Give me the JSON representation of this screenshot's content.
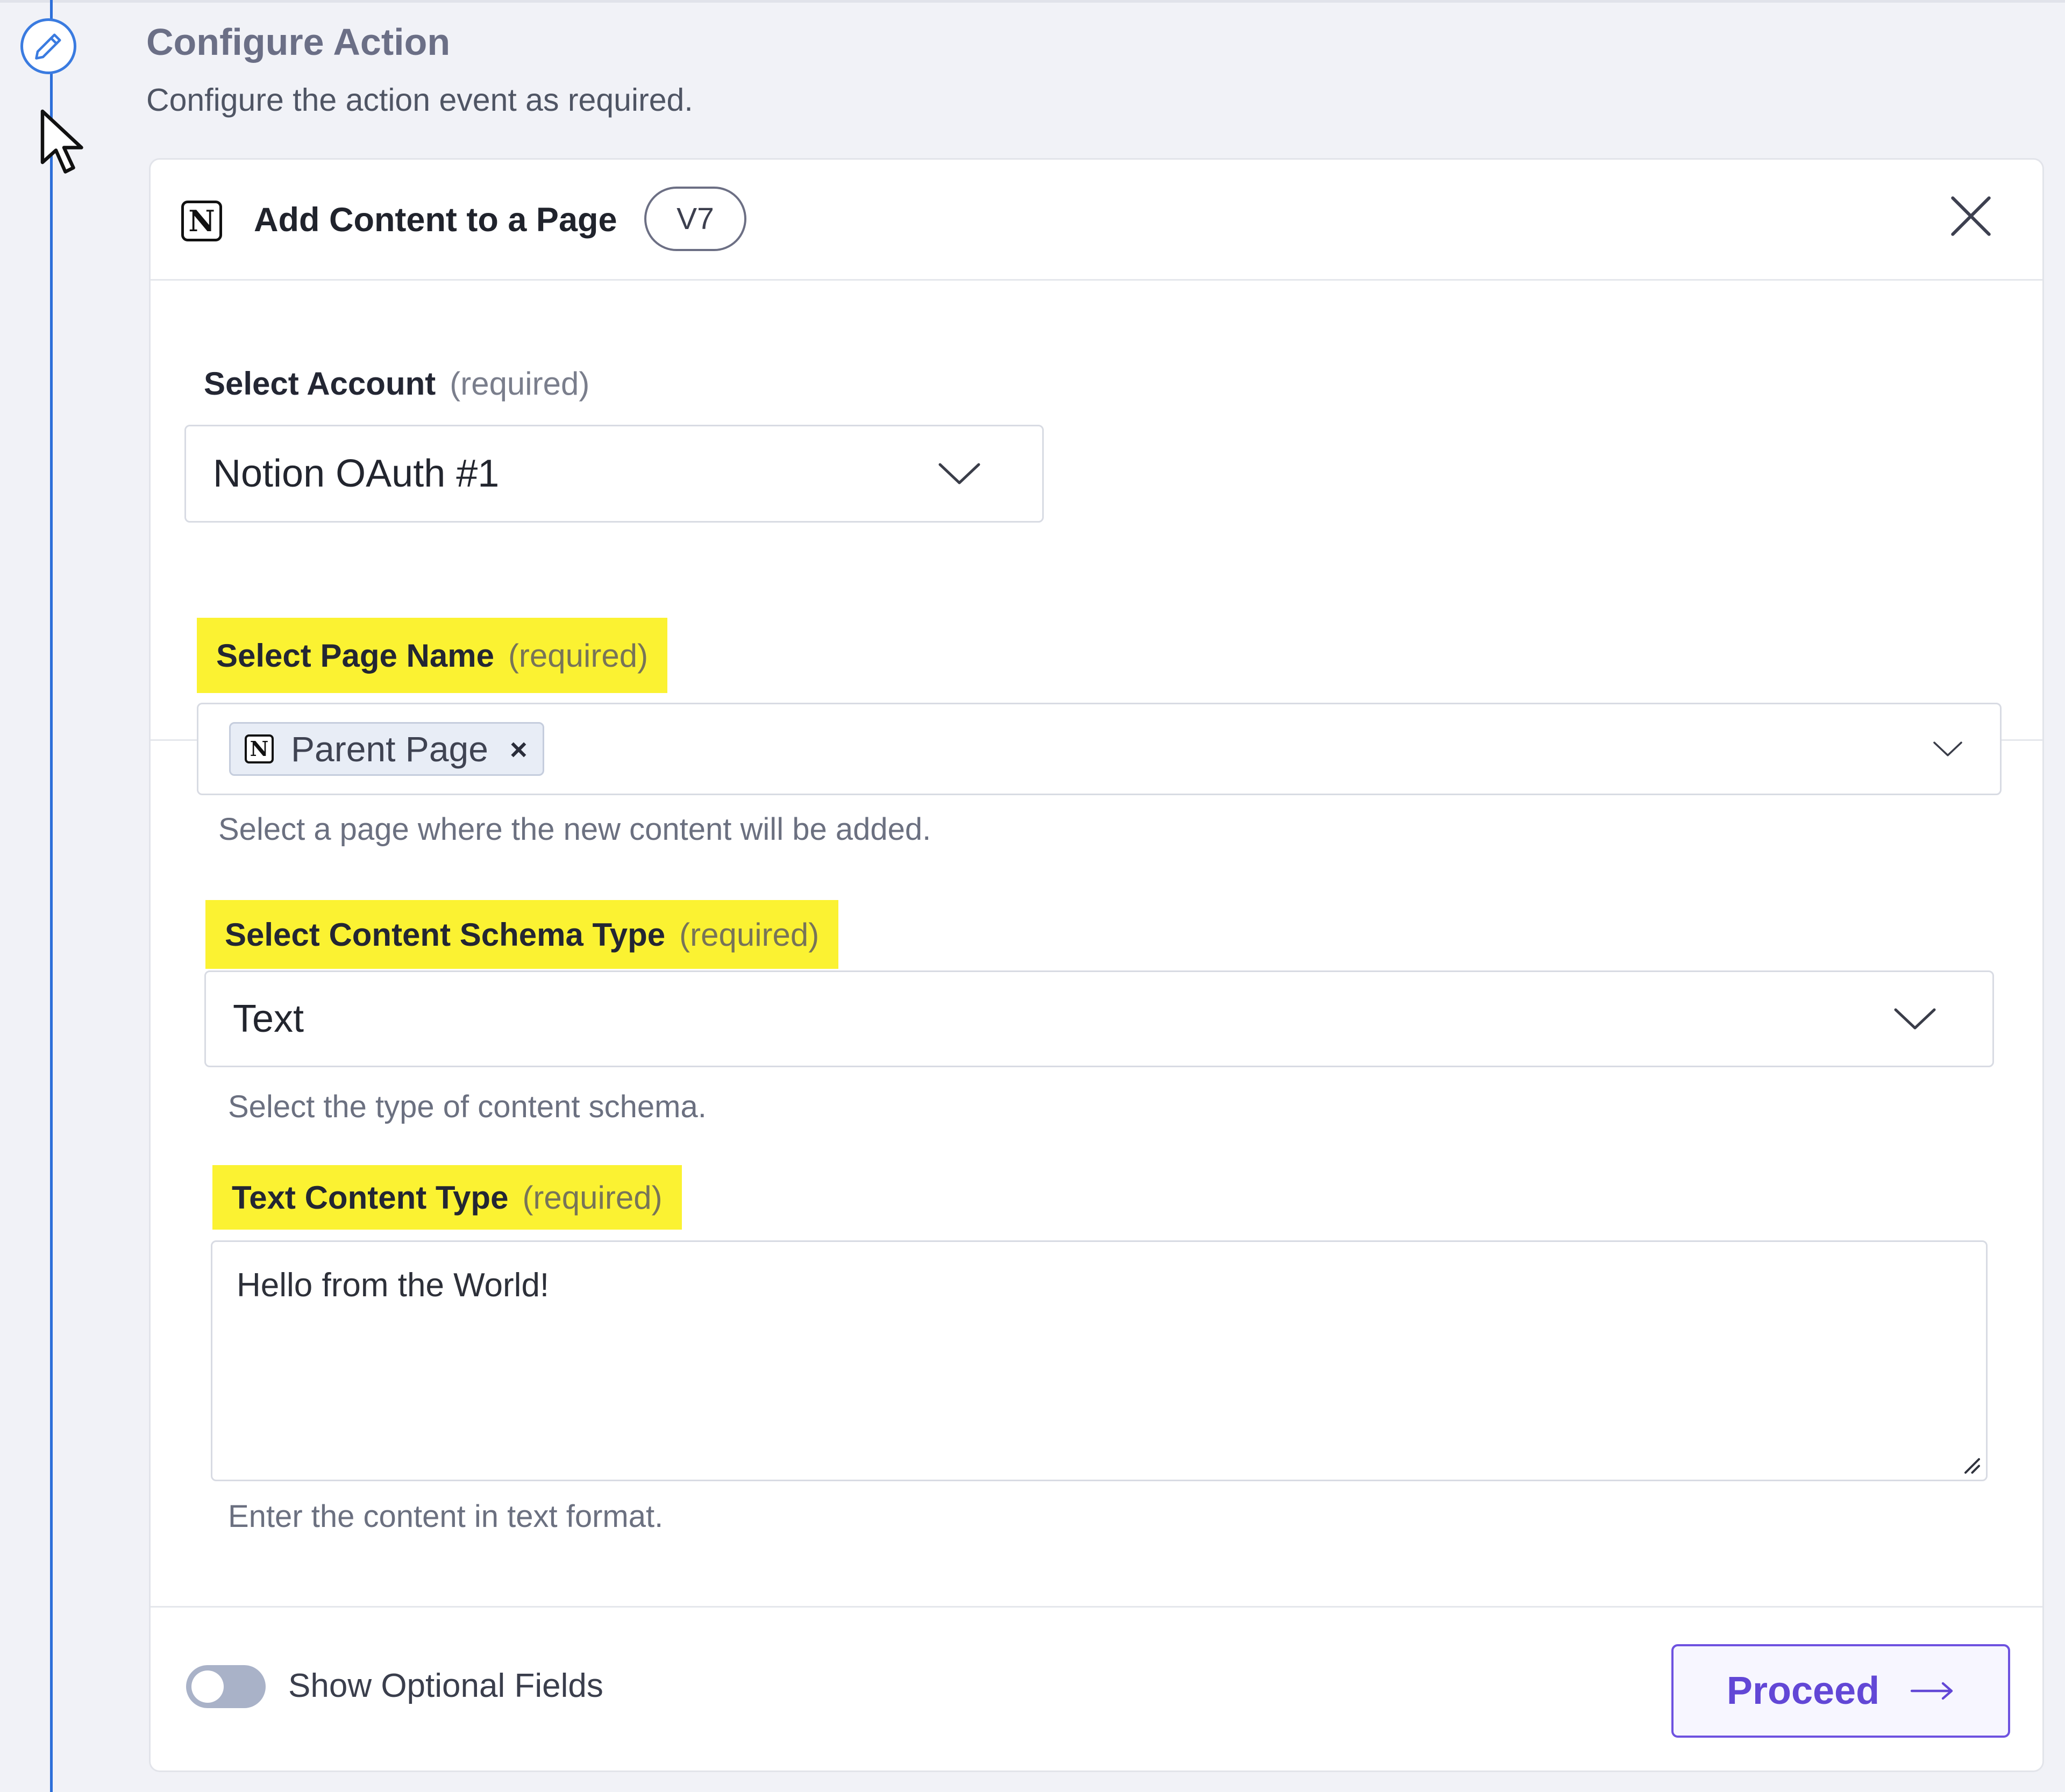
{
  "step": {
    "title": "Configure Action",
    "subtitle": "Configure the action event as required."
  },
  "card": {
    "title": "Add Content to a Page",
    "version": "V7",
    "app_logo_letter": "N"
  },
  "fields": {
    "account": {
      "label": "Select Account",
      "required": "(required)",
      "value": "Notion OAuth #1"
    },
    "page_name": {
      "label": "Select Page Name",
      "required": "(required)",
      "chip": "Parent Page",
      "chip_remove": "×",
      "help": "Select a page where the new content will be added."
    },
    "schema_type": {
      "label": "Select Content Schema Type",
      "required": "(required)",
      "value": "Text",
      "help": "Select the type of content schema."
    },
    "text_content": {
      "label": "Text Content Type",
      "required": "(required)",
      "value": "Hello from the World!",
      "help": "Enter the content in text format."
    }
  },
  "footer": {
    "toggle_label": "Show Optional Fields",
    "toggle_on": false,
    "proceed_label": "Proceed"
  },
  "icons": {
    "step": "pencil-icon",
    "close": "close-icon",
    "dropdown": "chevron-down-icon",
    "proceed": "arrow-right-icon"
  },
  "colors": {
    "highlight": "#fbf232",
    "accent": "#6247d6",
    "rail": "#2d6fd9"
  }
}
